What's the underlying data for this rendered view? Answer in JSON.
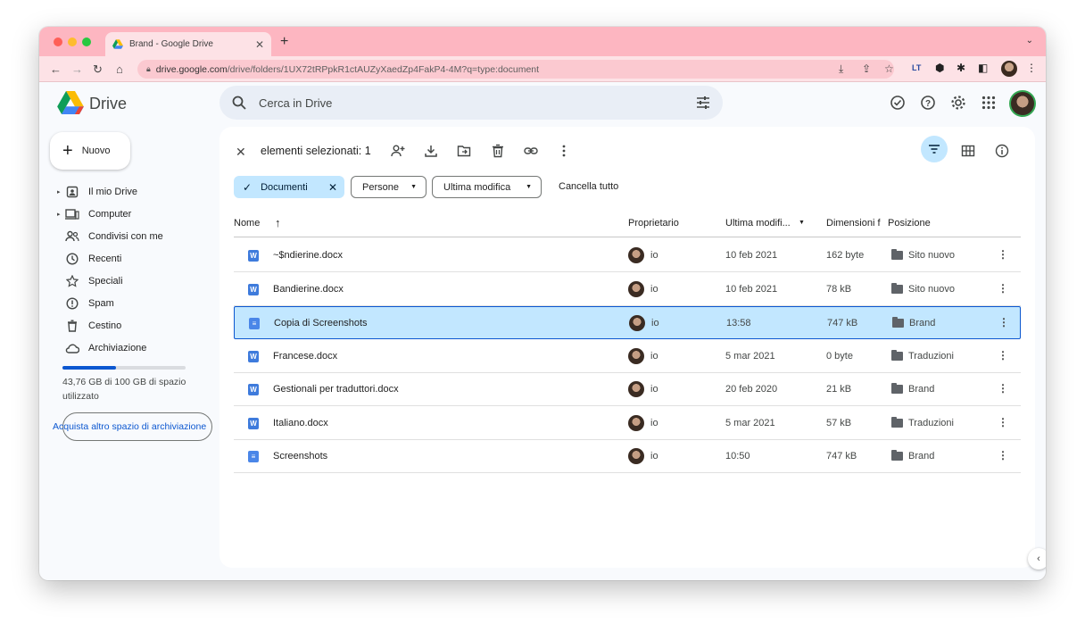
{
  "browser": {
    "tab_title": "Brand - Google Drive",
    "tab_close": "✕",
    "new_tab": "+",
    "url_host": "drive.google.com",
    "url_path": "/drive/folders/1UX72tRPpkR1ctAUZyXaedZp4FakP4-4M?q=type:document",
    "ext_label": "LT"
  },
  "app": {
    "name": "Drive",
    "search_placeholder": "Cerca in Drive"
  },
  "sidebar": {
    "new_label": "Nuovo",
    "items": [
      {
        "label": "Il mio Drive",
        "icon": "my-drive-icon",
        "caret": true
      },
      {
        "label": "Computer",
        "icon": "computer-icon",
        "caret": true
      },
      {
        "label": "Condivisi con me",
        "icon": "shared-icon",
        "caret": false
      },
      {
        "label": "Recenti",
        "icon": "clock-icon",
        "caret": false
      },
      {
        "label": "Speciali",
        "icon": "star-icon",
        "caret": false
      },
      {
        "label": "Spam",
        "icon": "spam-icon",
        "caret": false
      },
      {
        "label": "Cestino",
        "icon": "trash-icon",
        "caret": false
      },
      {
        "label": "Archiviazione",
        "icon": "cloud-icon",
        "caret": false
      }
    ],
    "storage_text": "43,76 GB di 100 GB di spazio utilizzato",
    "storage_fraction": 0.4376,
    "buy_label": "Acquista altro spazio di archiviazione"
  },
  "selection": {
    "count_label": "elementi selezionati: 1"
  },
  "filters": {
    "active": "Documenti",
    "people": "Persone",
    "modified": "Ultima modifica",
    "clear": "Cancella tutto"
  },
  "table": {
    "headers": {
      "name": "Nome",
      "owner": "Proprietario",
      "modified": "Ultima modifi...",
      "size": "Dimensioni f",
      "location": "Posizione"
    },
    "rows": [
      {
        "name": "~$ndierine.docx",
        "type": "word",
        "owner": "io",
        "modified": "10 feb 2021",
        "size": "162 byte",
        "location": "Sito nuovo",
        "selected": false
      },
      {
        "name": "Bandierine.docx",
        "type": "word",
        "owner": "io",
        "modified": "10 feb 2021",
        "size": "78 kB",
        "location": "Sito nuovo",
        "selected": false
      },
      {
        "name": "Copia di Screenshots",
        "type": "doc",
        "owner": "io",
        "modified": "13:58",
        "size": "747 kB",
        "location": "Brand",
        "selected": true
      },
      {
        "name": "Francese.docx",
        "type": "word",
        "owner": "io",
        "modified": "5 mar 2021",
        "size": "0 byte",
        "location": "Traduzioni",
        "selected": false
      },
      {
        "name": "Gestionali per traduttori.docx",
        "type": "word",
        "owner": "io",
        "modified": "20 feb 2020",
        "size": "21 kB",
        "location": "Brand",
        "selected": false
      },
      {
        "name": "Italiano.docx",
        "type": "word",
        "owner": "io",
        "modified": "5 mar 2021",
        "size": "57 kB",
        "location": "Traduzioni",
        "selected": false
      },
      {
        "name": "Screenshots",
        "type": "doc",
        "owner": "io",
        "modified": "10:50",
        "size": "747 kB",
        "location": "Brand",
        "selected": false
      }
    ]
  },
  "colors": {
    "tab_bar": "#fdb6c1",
    "toolbar": "#fde2e6",
    "accent": "#0b57d0",
    "selected_row": "#c2e7ff"
  }
}
